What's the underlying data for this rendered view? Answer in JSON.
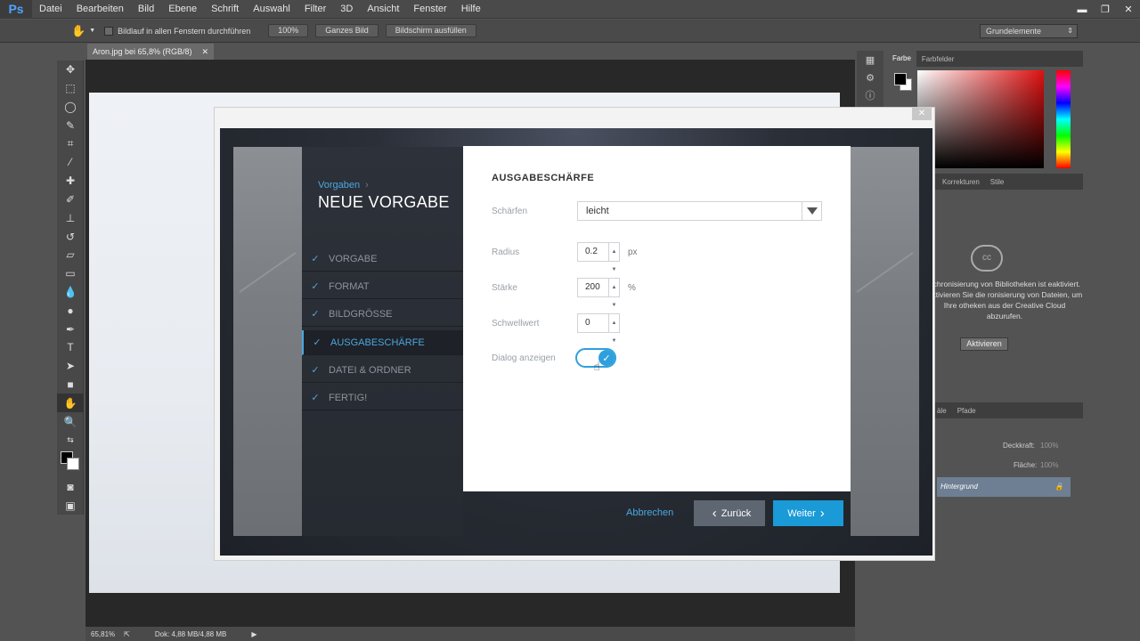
{
  "app": {
    "logo": "Ps"
  },
  "menu": [
    "Datei",
    "Bearbeiten",
    "Bild",
    "Ebene",
    "Schrift",
    "Auswahl",
    "Filter",
    "3D",
    "Ansicht",
    "Fenster",
    "Hilfe"
  ],
  "options": {
    "scroll_all_label": "Bildlauf in allen Fenstern durchführen",
    "zoom_100": "100%",
    "fit_screen": "Ganzes Bild",
    "fill_screen": "Bildschirm ausfüllen",
    "workspace": "Grundelemente"
  },
  "document": {
    "tab_title": "Aron.jpg bei 65,8% (RGB/8)",
    "zoom": "65,81%",
    "doc_size": "Dok: 4,88 MB/4,88 MB"
  },
  "panels": {
    "color_tabs": [
      "Farbe",
      "Farbfelder"
    ],
    "adjust_tabs": [
      "Korrekturen",
      "Stile"
    ],
    "libraries_text": "nchronisierung von Bibliotheken ist eaktiviert. Aktivieren Sie die ronisierung von Dateien, um Ihre otheken aus der Creative Cloud abzurufen.",
    "libraries_button": "Aktivieren",
    "layers_tabs": [
      "äle",
      "Pfade"
    ],
    "opacity_label": "Deckkraft:",
    "opacity_value": "100%",
    "fill_label": "Fläche:",
    "fill_value": "100%",
    "layer_name": "Hintergrund"
  },
  "dialog": {
    "breadcrumb": "Vorgaben",
    "title": "NEUE VORGABE",
    "steps": [
      {
        "label": "VORGABE",
        "done": true
      },
      {
        "label": "FORMAT",
        "done": true
      },
      {
        "label": "BILDGRÖSSE",
        "done": true
      },
      {
        "label": "AUSGABESCHÄRFE",
        "done": true,
        "current": true
      },
      {
        "label": "DATEI & ORDNER",
        "done": true
      },
      {
        "label": "FERTIG!",
        "done": true
      }
    ],
    "section_title": "AUSGABESCHÄRFE",
    "sharpen_label": "Schärfen",
    "sharpen_value": "leicht",
    "radius_label": "Radius",
    "radius_value": "0.2",
    "radius_unit": "px",
    "amount_label": "Stärke",
    "amount_value": "200",
    "amount_unit": "%",
    "threshold_label": "Schwellwert",
    "threshold_value": "0",
    "show_dialog_label": "Dialog anzeigen",
    "show_dialog_on": true,
    "cancel": "Abbrechen",
    "back": "Zurück",
    "next": "Weiter"
  },
  "colors": {
    "accent": "#2ea0dc",
    "next_button": "#1a9ad6",
    "back_button": "#5e6672",
    "ps_blue": "#4ea3ff"
  }
}
